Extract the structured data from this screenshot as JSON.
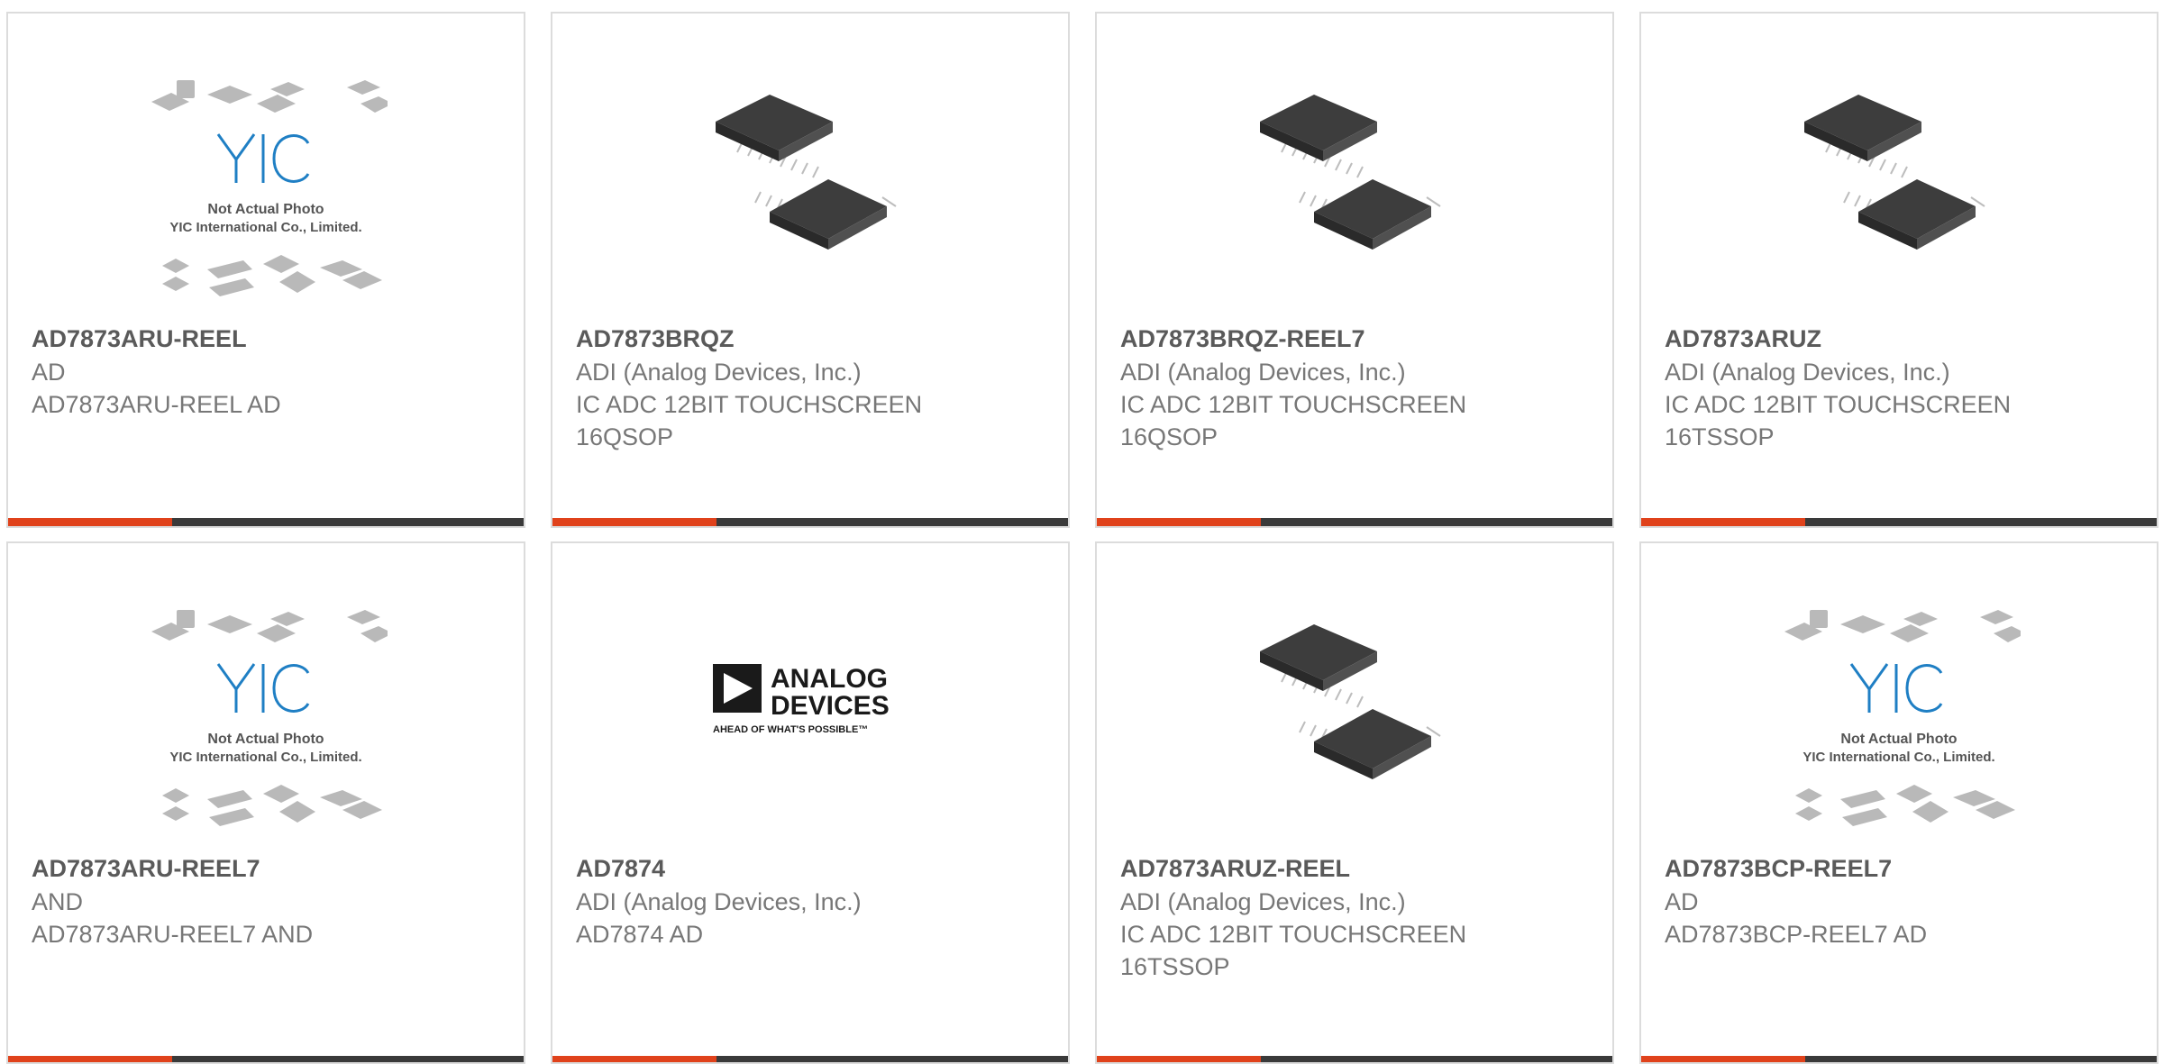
{
  "theme": {
    "accent": "#e0421b",
    "bar": "#3a3a3a",
    "border": "#dcdcdc",
    "yic_blue": "#1f7fc4"
  },
  "products": [
    {
      "part_number": "AD7873ARU-REEL",
      "manufacturer": "AD",
      "description": "AD7873ARU-REEL AD",
      "image": "yic-placeholder",
      "placeholder_line1": "Not Actual Photo",
      "placeholder_line2": "YIC International Co., Limited."
    },
    {
      "part_number": "AD7873BRQZ",
      "manufacturer": "ADI (Analog Devices, Inc.)",
      "description": "IC ADC 12BIT TOUCHSCREEN 16QSOP",
      "image": "chip-photo"
    },
    {
      "part_number": "AD7873BRQZ-REEL7",
      "manufacturer": "ADI (Analog Devices, Inc.)",
      "description": "IC ADC 12BIT TOUCHSCREEN 16QSOP",
      "image": "chip-photo"
    },
    {
      "part_number": "AD7873ARUZ",
      "manufacturer": "ADI (Analog Devices, Inc.)",
      "description": "IC ADC 12BIT TOUCHSCREEN 16TSSOP",
      "image": "chip-photo"
    },
    {
      "part_number": "AD7873ARU-REEL7",
      "manufacturer": "AND",
      "description": "AD7873ARU-REEL7 AND",
      "image": "yic-placeholder",
      "placeholder_line1": "Not Actual Photo",
      "placeholder_line2": "YIC International Co., Limited."
    },
    {
      "part_number": "AD7874",
      "manufacturer": "ADI (Analog Devices, Inc.)",
      "description": "AD7874 AD",
      "image": "analog-devices-logo",
      "logo_line1": "ANALOG",
      "logo_line2": "DEVICES",
      "logo_tagline": "AHEAD OF WHAT'S POSSIBLE™"
    },
    {
      "part_number": "AD7873ARUZ-REEL",
      "manufacturer": "ADI (Analog Devices, Inc.)",
      "description": "IC ADC 12BIT TOUCHSCREEN 16TSSOP",
      "image": "chip-photo"
    },
    {
      "part_number": "AD7873BCP-REEL7",
      "manufacturer": "AD",
      "description": "AD7873BCP-REEL7 AD",
      "image": "yic-placeholder",
      "placeholder_line1": "Not Actual Photo",
      "placeholder_line2": "YIC International Co., Limited."
    }
  ]
}
